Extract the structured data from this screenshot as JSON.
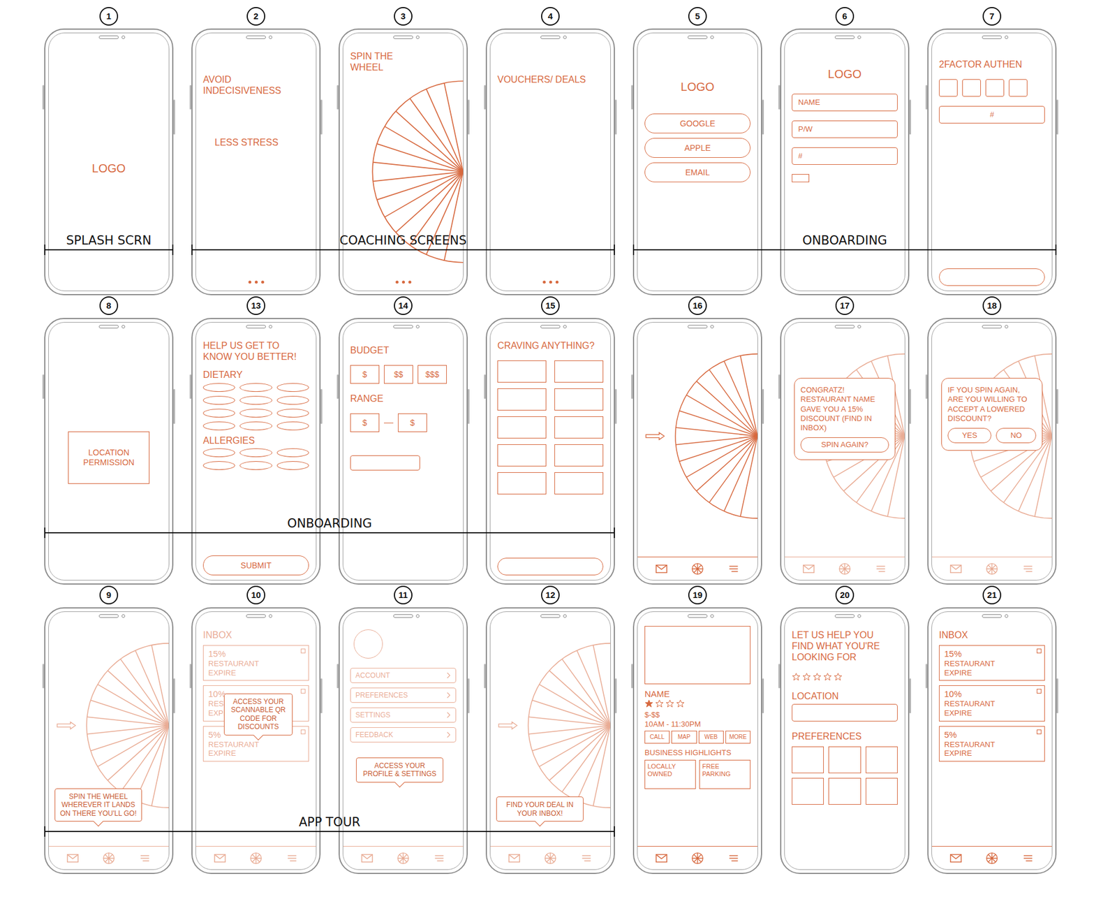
{
  "rows": [
    {
      "screens": [
        {
          "number": "1",
          "kind": "splash",
          "dimmed": false,
          "logo": "LOGO"
        },
        {
          "number": "2",
          "kind": "coach",
          "dimmed": false,
          "lines": [
            "AVOID INDECISIVENESS",
            "LESS STRESS"
          ]
        },
        {
          "number": "3",
          "kind": "coach-wheel",
          "dimmed": false,
          "title": "SPIN THE WHEEL"
        },
        {
          "number": "4",
          "kind": "coach",
          "dimmed": false,
          "lines": [
            "VOUCHERS/ DEALS"
          ]
        },
        {
          "number": "5",
          "kind": "login",
          "dimmed": false,
          "logo": "LOGO",
          "buttons": [
            "GOOGLE",
            "APPLE",
            "EMAIL"
          ]
        },
        {
          "number": "6",
          "kind": "signup",
          "dimmed": false,
          "logo": "LOGO",
          "fields": [
            "NAME",
            "P/W",
            "#"
          ],
          "checkbox_checked": false
        },
        {
          "number": "7",
          "kind": "auth",
          "dimmed": false,
          "title": "2FACTOR AUTHEN",
          "boxes": 4,
          "field": "#"
        }
      ],
      "sections": [
        {
          "label": "SPLASH SCRN",
          "count": 1
        },
        {
          "label": "COACHING SCREENS",
          "count": 3
        },
        {
          "label": "ONBOARDING",
          "count": 3
        }
      ]
    },
    {
      "screens": [
        {
          "number": "8",
          "kind": "permission",
          "dimmed": false,
          "box": "LOCATION PERMISSION"
        },
        {
          "number": "13",
          "kind": "preferences",
          "dimmed": false,
          "title": "HELP US GET TO KNOW YOU BETTER!",
          "groups": [
            {
              "label": "DIETARY",
              "options": 12
            },
            {
              "label": "ALLERGIES",
              "options": 6
            }
          ],
          "button": "SUBMIT"
        },
        {
          "number": "14",
          "kind": "budget",
          "dimmed": false,
          "title": "BUDGET",
          "options": [
            "$",
            "$$",
            "$$$"
          ],
          "range_label": "RANGE",
          "range": [
            "$",
            "$"
          ]
        },
        {
          "number": "15",
          "kind": "craving",
          "dimmed": false,
          "title": "CRAVING ANYTHING?",
          "tiles": 10
        },
        {
          "number": "16",
          "kind": "wheel",
          "dimmed": false
        },
        {
          "number": "17",
          "kind": "wheel-popup",
          "dimmed": true,
          "popup": "CONGRATZ! RESTAURANT NAME GAVE YOU A 15% DISCOUNT (FIND IN INBOX)",
          "buttons": [
            "SPIN AGAIN?"
          ]
        },
        {
          "number": "18",
          "kind": "wheel-popup",
          "dimmed": true,
          "popup": "IF YOU SPIN AGAIN, ARE YOU WILLING TO ACCEPT A LOWERED DISCOUNT?",
          "buttons": [
            "YES",
            "NO"
          ]
        }
      ],
      "sections": [
        {
          "label": "ONBOARDING",
          "count": 4
        }
      ]
    },
    {
      "screens": [
        {
          "number": "9",
          "kind": "wheel-tour",
          "dimmed": true,
          "tip": "SPIN THE WHEEL WHEREVER IT LANDS ON THERE YOU'LL GO!"
        },
        {
          "number": "10",
          "kind": "inbox",
          "dimmed": true,
          "title": "INBOX",
          "deals": [
            {
              "discount": "15%",
              "name": "RESTAURANT",
              "expire": "EXPIRE"
            },
            {
              "discount": "10%",
              "name": "RESTAURANT",
              "expire": "EXPIRE"
            },
            {
              "discount": "5%",
              "name": "RESTAURANT",
              "expire": "EXPIRE"
            }
          ],
          "tip": "ACCESS YOUR SCANNABLE QR CODE FOR DISCOUNTS"
        },
        {
          "number": "11",
          "kind": "profile",
          "dimmed": true,
          "menu": [
            "ACCOUNT",
            "PREFERENCES",
            "SETTINGS",
            "FEEDBACK"
          ],
          "tip": "ACCESS YOUR PROFILE & SETTINGS"
        },
        {
          "number": "12",
          "kind": "wheel-tour",
          "dimmed": true,
          "tip": "FIND YOUR DEAL IN YOUR INBOX!"
        },
        {
          "number": "19",
          "kind": "detail",
          "dimmed": false,
          "name": "NAME",
          "rating": {
            "stars": 1,
            "max": 4
          },
          "price": "$-$$",
          "hours": "10AM - 11:30PM",
          "actions": [
            "CALL",
            "MAP",
            "WEB",
            "MORE"
          ],
          "highlights_title": "BUSINESS HIGHLIGHTS",
          "highlights": [
            "LOCALLY OWNED",
            "FREE PARKING"
          ]
        },
        {
          "number": "20",
          "kind": "filter",
          "dimmed": false,
          "title": "LET US HELP YOU FIND WHAT YOU'RE LOOKING FOR",
          "rating": {
            "stars": 0,
            "max": 5
          },
          "location_label": "LOCATION",
          "preferences_label": "PREFERENCES",
          "tiles": 6
        },
        {
          "number": "21",
          "kind": "inbox",
          "dimmed": false,
          "title": "INBOX",
          "deals": [
            {
              "discount": "15%",
              "name": "RESTAURANT",
              "expire": "EXPIRE"
            },
            {
              "discount": "10%",
              "name": "RESTAURANT",
              "expire": "EXPIRE"
            },
            {
              "discount": "5%",
              "name": "RESTAURANT",
              "expire": "EXPIRE"
            }
          ]
        }
      ],
      "sections": [
        {
          "label": "APP TOUR",
          "count": 4
        }
      ]
    }
  ]
}
